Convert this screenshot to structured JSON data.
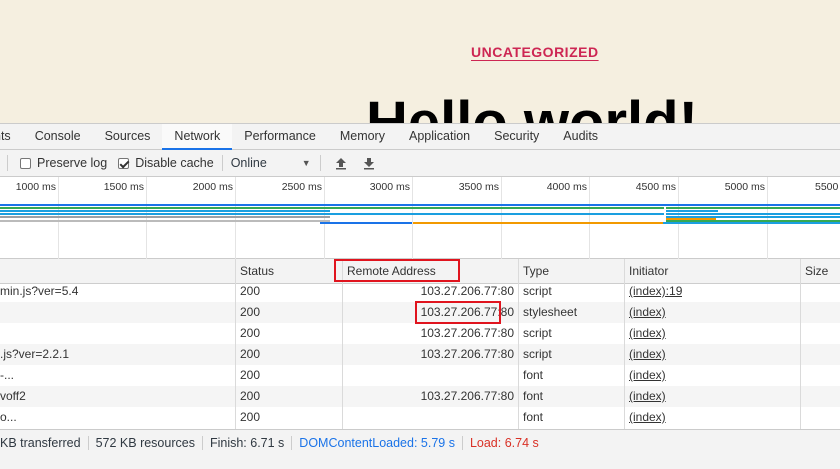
{
  "page": {
    "category": "UNCATEGORIZED",
    "title": "Hello world!"
  },
  "devtools": {
    "tabs": [
      "nts",
      "Console",
      "Sources",
      "Network",
      "Performance",
      "Memory",
      "Application",
      "Security",
      "Audits"
    ],
    "active_tab": "Network"
  },
  "toolbar": {
    "preserve_log": "Preserve log",
    "preserve_log_checked": false,
    "disable_cache": "Disable cache",
    "disable_cache_checked": true,
    "throttle": "Online",
    "icons": [
      "upload-icon",
      "download-icon"
    ]
  },
  "overview": {
    "ticks": [
      "1000 ms",
      "1500 ms",
      "2000 ms",
      "2500 ms",
      "3000 ms",
      "3500 ms",
      "4000 ms",
      "4500 ms",
      "5000 ms",
      "5500"
    ]
  },
  "table": {
    "columns": [
      "Status",
      "Remote Address",
      "Type",
      "Initiator",
      "Size"
    ],
    "rows": [
      {
        "name": "min.js?ver=5.4",
        "status": "200",
        "remote": "103.27.206.77:80",
        "type": "script",
        "initiator": "(index):19"
      },
      {
        "name": "",
        "status": "200",
        "remote": "103.27.206.77:80",
        "type": "stylesheet",
        "initiator": "(index)"
      },
      {
        "name": "",
        "status": "200",
        "remote": "103.27.206.77:80",
        "type": "script",
        "initiator": "(index)"
      },
      {
        "name": ".js?ver=2.2.1",
        "status": "200",
        "remote": "103.27.206.77:80",
        "type": "script",
        "initiator": "(index)"
      },
      {
        "name": "-...",
        "status": "200",
        "remote": "",
        "type": "font",
        "initiator": "(index)"
      },
      {
        "name": "voff2",
        "status": "200",
        "remote": "103.27.206.77:80",
        "type": "font",
        "initiator": "(index)"
      },
      {
        "name": "o...",
        "status": "200",
        "remote": "",
        "type": "font",
        "initiator": "(index)"
      }
    ]
  },
  "status": {
    "transferred": "KB transferred",
    "resources": "572 KB resources",
    "finish": "Finish: 6.71 s",
    "dcl": "DOMContentLoaded: 5.79 s",
    "load": "Load: 6.74 s"
  },
  "colors": {
    "accent": "#1a73e8",
    "category": "#cd2653",
    "highlight": "#e0141e",
    "dcl": "#1a73e8",
    "load": "#d93025"
  }
}
